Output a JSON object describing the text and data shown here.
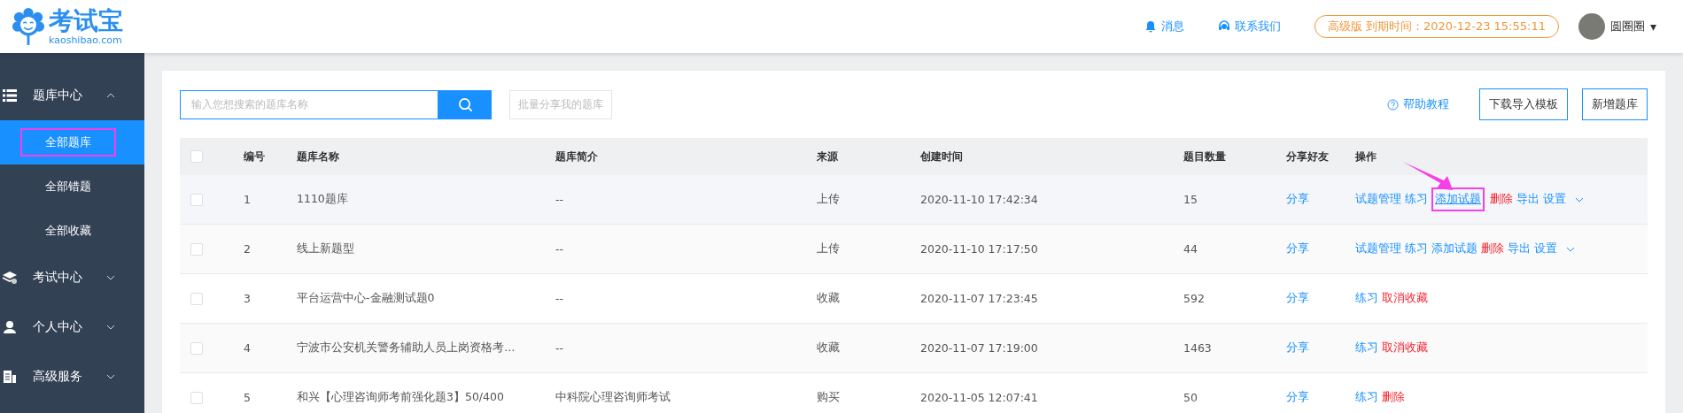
{
  "logo": {
    "name": "考试宝",
    "domain": "kaoshibao.com"
  },
  "header": {
    "links": [
      {
        "kind": "bell",
        "label": "消息"
      },
      {
        "kind": "headset",
        "label": "联系我们"
      }
    ],
    "plan_badge": "高级版 到期时间：2020-12-23 15:55:11",
    "user": {
      "name": "圆圈圈",
      "caret": "▾"
    }
  },
  "sidebar": {
    "items": [
      {
        "label": "题库中心",
        "expanded": true,
        "children": [
          {
            "label": "全部题库",
            "selected": true,
            "annotated": true
          },
          {
            "label": "全部错题",
            "selected": false,
            "annotated": false
          },
          {
            "label": "全部收藏",
            "selected": false,
            "annotated": false
          }
        ]
      },
      {
        "label": "考试中心",
        "expanded": false
      },
      {
        "label": "个人中心",
        "expanded": false
      },
      {
        "label": "高级服务",
        "expanded": false
      }
    ]
  },
  "toolbar": {
    "search": {
      "placeholder": "输入您想搜索的题库名称"
    },
    "batch_share": "批量分享我的题库",
    "help": "帮助教程",
    "buttons": [
      "下载导入模板",
      "新增题库"
    ]
  },
  "table": {
    "select_all_checked": false,
    "columns": [
      "编号",
      "题库名称",
      "题库简介",
      "来源",
      "创建时间",
      "题目数量",
      "分享好友",
      "操作"
    ],
    "rows": [
      {
        "checked": false,
        "hovered": true,
        "id": "1",
        "name": "1110题库",
        "intro": "--",
        "source": "上传",
        "created": "2020-11-10 17:42:34",
        "count": "15",
        "share": "分享",
        "actions": [
          {
            "label": "试题管理",
            "kind": "link",
            "annotated": false
          },
          {
            "label": "练习",
            "kind": "link",
            "annotated": false
          },
          {
            "label": "添加试题",
            "kind": "link",
            "annotated": true
          },
          {
            "label": "删除",
            "kind": "danger",
            "annotated": false
          },
          {
            "label": "导出",
            "kind": "link",
            "annotated": false
          },
          {
            "label": "设置",
            "kind": "link",
            "annotated": false
          }
        ],
        "more": true
      },
      {
        "checked": false,
        "hovered": false,
        "id": "2",
        "name": "线上新题型",
        "intro": "--",
        "source": "上传",
        "created": "2020-11-10 17:17:50",
        "count": "44",
        "share": "分享",
        "actions": [
          {
            "label": "试题管理",
            "kind": "link",
            "annotated": false
          },
          {
            "label": "练习",
            "kind": "link",
            "annotated": false
          },
          {
            "label": "添加试题",
            "kind": "link",
            "annotated": false
          },
          {
            "label": "删除",
            "kind": "danger",
            "annotated": false
          },
          {
            "label": "导出",
            "kind": "link",
            "annotated": false
          },
          {
            "label": "设置",
            "kind": "link",
            "annotated": false
          }
        ],
        "more": true
      },
      {
        "checked": false,
        "hovered": false,
        "id": "3",
        "name": "平台运营中心-金融测试题0",
        "intro": "--",
        "source": "收藏",
        "created": "2020-11-07 17:23:45",
        "count": "592",
        "share": "分享",
        "actions": [
          {
            "label": "练习",
            "kind": "link",
            "annotated": false
          },
          {
            "label": "取消收藏",
            "kind": "danger",
            "annotated": false
          }
        ],
        "more": false
      },
      {
        "checked": false,
        "hovered": false,
        "id": "4",
        "name": "宁波市公安机关警务辅助人员上岗资格考…",
        "intro": "--",
        "source": "收藏",
        "created": "2020-11-07 17:19:00",
        "count": "1463",
        "share": "分享",
        "actions": [
          {
            "label": "练习",
            "kind": "link",
            "annotated": false
          },
          {
            "label": "取消收藏",
            "kind": "danger",
            "annotated": false
          }
        ],
        "more": false
      },
      {
        "checked": false,
        "hovered": false,
        "id": "5",
        "name": "和兴【心理咨询师考前强化题3】50/400",
        "intro": "中科院心理咨询师考试",
        "source": "购买",
        "created": "2020-11-05 12:07:41",
        "count": "50",
        "share": "分享",
        "actions": [
          {
            "label": "练习",
            "kind": "link",
            "annotated": false
          },
          {
            "label": "删除",
            "kind": "danger",
            "annotated": false
          }
        ],
        "more": false
      }
    ]
  }
}
